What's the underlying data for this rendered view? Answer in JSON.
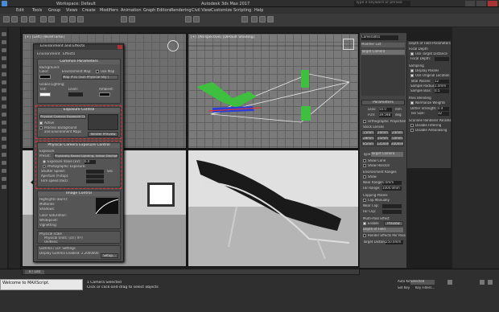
{
  "app": {
    "title_left": "Workspace: Default",
    "title_center": "Autodesk 3ds Max 2017",
    "search_placeholder": "Type a keyword or phrase"
  },
  "menubar": {
    "items": [
      "Edit",
      "Tools",
      "Group",
      "Views",
      "Create",
      "Modifiers",
      "Animation",
      "Graph Editors",
      "Rendering",
      "Civil View",
      "Customize",
      "Scripting",
      "Help"
    ]
  },
  "viewports": {
    "top_left": {
      "label": "[+] [Left] [Wireframe]"
    },
    "top_right": {
      "label": "[+] [Perspective] [Default Shading]"
    },
    "bottom_left": {
      "label": "[+] [Camera001] [Realistic]"
    },
    "bottom_right": {
      "label": "[+] [Camera002] [Realistic]"
    }
  },
  "env_dialog": {
    "title": "Environment and Effects",
    "tabs": [
      "Environment",
      "Effects"
    ],
    "common_params": "Common Parameters",
    "background": "Background:",
    "color_label": "Color:",
    "env_map": "Environment Map:",
    "use_map": "Use Map",
    "map_name": "Map #31 (Sun Physical Sky )",
    "global_lighting": "Global Lighting:",
    "tint": "Tint:",
    "level": "Level:",
    "ambient": "Ambient:",
    "exposure_control": "Exposure Control",
    "exposure_dropdown": "Physical Camera Exposure Control",
    "active": "Active",
    "process_bg": "Process Background",
    "and_env_maps": "and Environment Maps",
    "render_preview": "Render Preview",
    "physical_section": "Physical Camera Exposure Control",
    "exposure_label": "Exposure",
    "preset_label": "Preset:",
    "preset_value": "Physically Based Lighting, Indoor Daylight",
    "exposure_value": "Exposure Value (EV):",
    "ev_number": "6.0",
    "photographic": "Photographic Exposure:",
    "shutter": "Shutter Speed:",
    "aperture": "Aperture (f-stop):",
    "film_speed": "Film speed (ISO):",
    "sec": "Sec.",
    "image_control": "Image Control",
    "highlights": "Highlights (Burn):",
    "midtones": "Midtones:",
    "shadows": "Shadows:",
    "color_saturation": "Color Saturation:",
    "whitepoint": "Whitepoint:",
    "vignetting": "Vignetting:",
    "physical_scale": "Physical scale",
    "physical_units": "Physical Units: (cd / m²)",
    "unitless": "Unitless:",
    "gamma": "Gamma / LUT Settings",
    "display_gamma": "Display Gamma Enabled: 2.2000000",
    "setup": "Setup..."
  },
  "command_panel": {
    "object_name": "Camera001",
    "modifier_list": "Modifier List",
    "stack_item": "Target Camera",
    "parameters": "Parameters",
    "lens": "Lens:",
    "lens_value": "50.0",
    "lens_unit": "mm",
    "fov": "FOV:",
    "fov_value": "39.598",
    "fov_unit": "deg",
    "ortho": "Orthographic Projection",
    "stock_lenses": "Stock Lenses",
    "lens_buttons": [
      "15mm",
      "20mm",
      "24mm",
      "28mm",
      "35mm",
      "50mm",
      "85mm",
      "135mm",
      "200mm"
    ],
    "type_label": "Type:",
    "type_value": "Target Camera",
    "show_cone": "Show Cone",
    "show_horizon": "Show Horizon",
    "env_ranges": "Environment Ranges",
    "show": "Show",
    "near_range": "Near Range:",
    "far_range": "Far Range:",
    "near_value": "0.0mm",
    "far_value": "1000.0mm",
    "clipping_planes": "Clipping Planes",
    "clip_manually": "Clip Manually",
    "near_clip": "Near Clip:",
    "far_clip": "Far Clip:",
    "multipass": "Multi-Pass Effect",
    "enable": "Enable",
    "preview": "Preview",
    "dof_value": "Depth of Field",
    "render_effects": "Render Effects Per Pass",
    "target_distance": "Target Distance:",
    "target_value": "250.0mm"
  },
  "dof_panel": {
    "title": "Depth of Field Parameters",
    "focal_depth": "Focal Depth",
    "use_target": "Use Target Distance",
    "focal_depth_label": "Focal Depth:",
    "sampling": "Sampling",
    "display_passes": "Display Passes",
    "use_original": "Use Original Location",
    "total_passes": "Total Passes:",
    "total_value": "12",
    "sample_radius": "Sample Radius:",
    "radius_value": "1.0mm",
    "sample_bias": "Sample Bias:",
    "bias_value": "0.5",
    "pass_blending": "Pass Blending",
    "normalize": "Normalize Weights",
    "dither_strength": "Dither Strength:",
    "dither_value": "0.4",
    "tile_size": "Tile Size:",
    "tile_value": "32",
    "scanline": "Scanline Renderer Params",
    "disable_filtering": "Disable Filtering",
    "disable_antialiasing": "Disable Antialiasing"
  },
  "status": {
    "maxscript": "Welcome to MAXScript.",
    "selected": "1 Camera Selected",
    "prompt": "Click or click-and-drag to select objects",
    "frame": "0 / 100",
    "auto_key": "Auto Key",
    "set_key": "Set Key",
    "selected_dropdown": "Selected",
    "key_filters": "Key Filters..."
  },
  "colors": {
    "accent_red": "#d33333",
    "chair_green": "#3fbf3f",
    "chair_blue": "#2a3fd6"
  }
}
